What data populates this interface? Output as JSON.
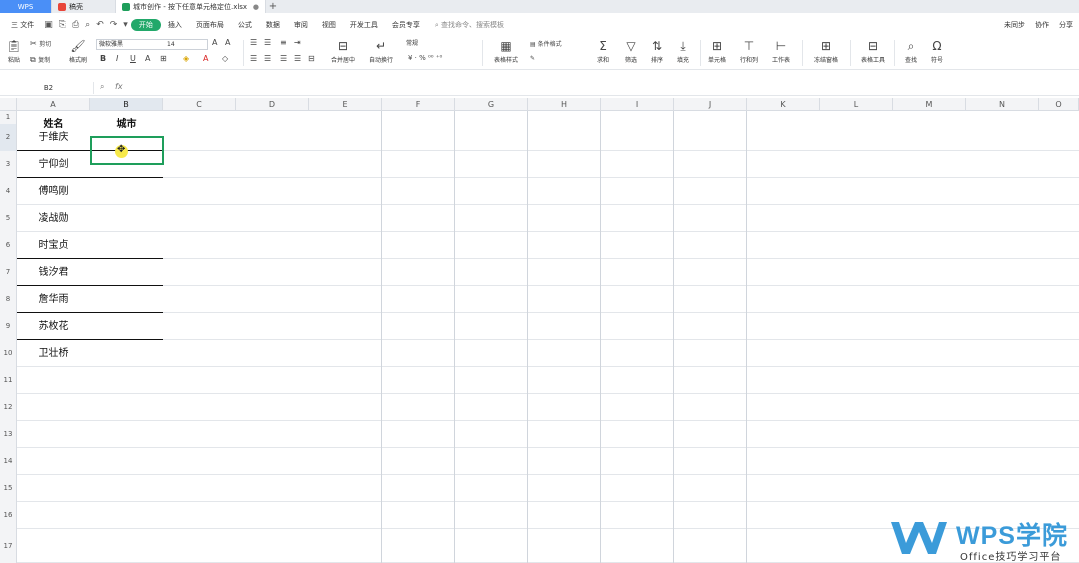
{
  "tabs": [
    {
      "label": "WPS",
      "style": "wps"
    },
    {
      "label": "稿壳",
      "style": "docs"
    },
    {
      "label": "城市创作 - 按下任意单元格定位.xlsx",
      "style": "active",
      "close": "●"
    }
  ],
  "tab_add": "+",
  "menu": {
    "file": "三 文件",
    "items": [
      "开始",
      "插入",
      "页面布局",
      "公式",
      "数据",
      "审阅",
      "视图",
      "开发工具",
      "会员专享"
    ],
    "active": "开始",
    "search": "查找命令、搜索模板",
    "right": [
      "未同步",
      "协作",
      "分享"
    ]
  },
  "ribbon": {
    "paste": "粘贴",
    "cut": "剪切",
    "copy": "复制",
    "format_painter": "格式刷",
    "font_name": "微软雅黑",
    "font_size": "14",
    "number_format": "常规",
    "merge": "合并居中",
    "wrap": "自动换行",
    "cond_fmt": "条件格式",
    "table_style": "表格样式",
    "sum": "求和",
    "filter": "筛选",
    "sort": "排序",
    "fill": "填充",
    "cell": "单元格",
    "rowcol": "行和列",
    "sheet": "工作表",
    "freeze": "冻结窗格",
    "tools": "表格工具",
    "find": "查找",
    "symbol": "符号"
  },
  "formula_bar": {
    "namebox": "B2",
    "fx": "fx",
    "value": ""
  },
  "columns": [
    "A",
    "B",
    "C",
    "D",
    "E",
    "F",
    "G",
    "H",
    "I",
    "J",
    "K",
    "L",
    "M",
    "N",
    "O"
  ],
  "rows": [
    "1",
    "2",
    "3",
    "4",
    "5",
    "6",
    "7",
    "8",
    "9",
    "10",
    "11",
    "12",
    "13",
    "14",
    "15",
    "16",
    "17"
  ],
  "sheet": {
    "header": {
      "name": "姓名",
      "city": "城市"
    },
    "names": [
      "于维庆",
      "宁仰剑",
      "傅鸣刚",
      "凌战勋",
      "时宝贞",
      "钱汐君",
      "詹华雨",
      "苏枚花",
      "卫壮桥"
    ]
  },
  "watermark": {
    "title": "WPS学院",
    "subtitle": "Office技巧学习平台"
  },
  "colors": {
    "accent": "#1e9e5b",
    "tab_wps": "#4a8ff7",
    "watermark": "#3b9bd9"
  }
}
